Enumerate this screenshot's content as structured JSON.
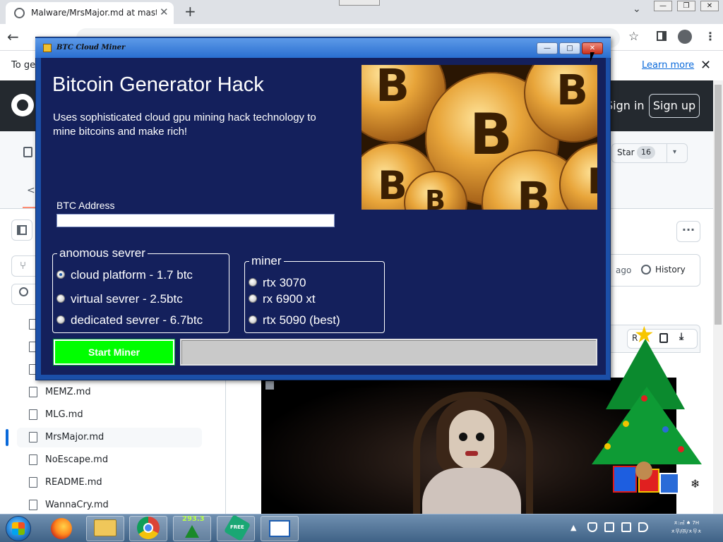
{
  "browser": {
    "tab_title": "Malware/MrsMajor.md at master",
    "tab_close": "✕",
    "new_tab": "+",
    "chevron": "⌄",
    "window_buttons": [
      "—",
      "❐",
      "✕"
    ],
    "back": "←",
    "star": "☆",
    "menu": "⋮"
  },
  "github": {
    "banner_text": "To get",
    "learn_more": "Learn more",
    "banner_close": "✕",
    "sign_in": "Sign in",
    "sign_up": "Sign up",
    "tab_arrow": "<",
    "star_label": "Star",
    "star_count": "16",
    "star_caret": "▾",
    "branch_icon": "⑂",
    "files": [
      "",
      "",
      "",
      "MEMZ.md",
      "MLG.md",
      "MrsMajor.md",
      "NoEscape.md",
      "README.md",
      "WannaCry.md"
    ],
    "kebab": "···",
    "ago": "ago",
    "history": "History",
    "raw": "R",
    "download_icon": "⤓"
  },
  "app": {
    "window_title": "BTC Cloud Miner",
    "min": "—",
    "max": "□",
    "close": "✕",
    "heading": "Bitcoin Generator Hack",
    "description": "Uses sophisticated cloud gpu mining hack technology to mine bitcoins and make rich!",
    "btc_label": "BTC Address",
    "btc_value": "",
    "server_group": {
      "title": "anomous sevrer",
      "options": [
        {
          "label": "cloud platform - 1.7 btc",
          "checked": true
        },
        {
          "label": "virtual sevrer - 2.5btc",
          "checked": false
        },
        {
          "label": "dedicated sevrer - 6.7btc",
          "checked": false
        }
      ]
    },
    "miner_group": {
      "title": "miner",
      "options": [
        {
          "label": "rtx 3070",
          "checked": false
        },
        {
          "label": "rx 6900 xt",
          "checked": false
        },
        {
          "label": "rtx 5090 (best)",
          "checked": false
        }
      ]
    },
    "start_button": "Start Miner",
    "progress": 0,
    "coin_symbol": "B"
  },
  "desktop": {
    "tree_star": "★",
    "snowflake": "❄"
  },
  "taskbar": {
    "tree_counter": "293.3",
    "free_label": "FREE",
    "tray_arrow": "▲",
    "clock_line1": "ㅊ:㎥ ♠ 7H",
    "clock_line2": "ㅊ무/㈜/ㅊ무ㅊ"
  },
  "colors": {
    "app_bg": "#14205c",
    "start_button": "#00ff00",
    "github_header": "#24292f",
    "link": "#0969da",
    "taskbar": "#4f7196"
  }
}
